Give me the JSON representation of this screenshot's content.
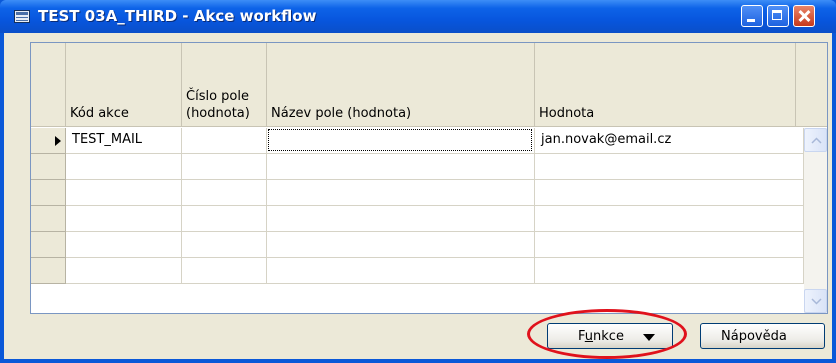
{
  "window": {
    "title": "TEST 03A_THIRD - Akce workflow",
    "icon": "table-window-icon",
    "controls": [
      "minimize-icon",
      "maximize-icon",
      "close-icon"
    ]
  },
  "grid": {
    "columns": [
      {
        "key": "kod_akce",
        "label": "Kód akce"
      },
      {
        "key": "cislo_pole",
        "label_line1": "Číslo pole",
        "label_line2": "(hodnota)"
      },
      {
        "key": "nazev_pole",
        "label": "Název pole (hodnota)"
      },
      {
        "key": "hodnota",
        "label": "Hodnota"
      }
    ],
    "rows": [
      {
        "kod_akce": "TEST_MAIL",
        "cislo_pole": "",
        "nazev_pole": "",
        "hodnota": "jan.novak@email.cz",
        "current": true
      },
      {
        "kod_akce": "",
        "cislo_pole": "",
        "nazev_pole": "",
        "hodnota": ""
      },
      {
        "kod_akce": "",
        "cislo_pole": "",
        "nazev_pole": "",
        "hodnota": ""
      },
      {
        "kod_akce": "",
        "cislo_pole": "",
        "nazev_pole": "",
        "hodnota": ""
      },
      {
        "kod_akce": "",
        "cislo_pole": "",
        "nazev_pole": "",
        "hodnota": ""
      },
      {
        "kod_akce": "",
        "cislo_pole": "",
        "nazev_pole": "",
        "hodnota": ""
      }
    ]
  },
  "buttons": {
    "funkce": {
      "label_before": "F",
      "label_mnemonic": "u",
      "label_after": "nkce"
    },
    "help": {
      "label": "Nápověda"
    }
  },
  "colors": {
    "titlebar": "#0a58d8",
    "client": "#ece9d8",
    "highlight": "#e0121c"
  }
}
